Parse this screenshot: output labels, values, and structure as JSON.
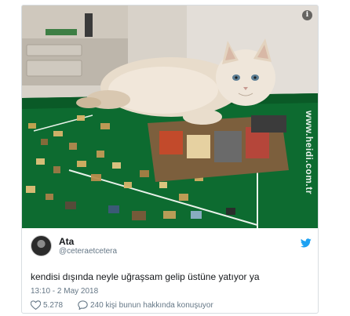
{
  "tweet": {
    "author_name": "Ata",
    "author_handle": "@ceteraetcetera",
    "text": "kendisi dışında neyle uğraşsam gelip üstüne yatıyor ya",
    "timestamp": "13:10 - 2 May 2018",
    "likes": "5.278",
    "replies_text": "240 kişi bunun hakkında konuşuyor"
  },
  "image": {
    "description_icon": "info-icon",
    "mat_text": "www.heidi.com.tr"
  },
  "icons": {
    "brand": "twitter-bird-icon",
    "like": "heart-icon",
    "reply": "speech-bubble-icon"
  },
  "colors": {
    "twitter_blue": "#1da1f2",
    "mat_green": "#0c6a2f",
    "secondary_text": "#657786"
  }
}
